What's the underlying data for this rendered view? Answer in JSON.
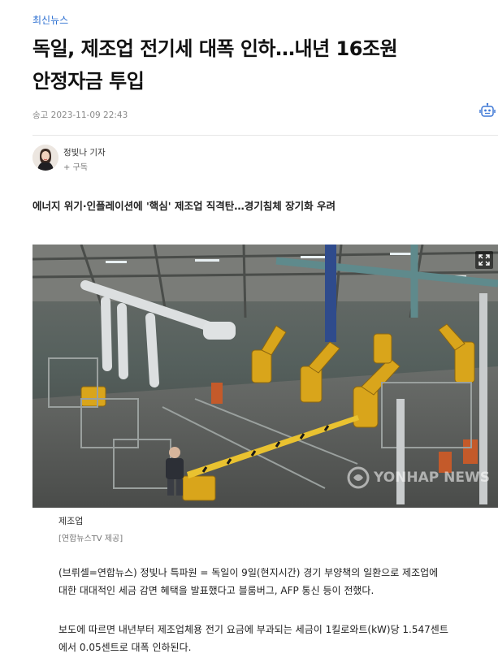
{
  "article": {
    "category": "최신뉴스",
    "title_line1": "독일, 제조업 전기세 대폭 인하…내년 16조원",
    "title_line2": "안정자금 투입",
    "send_time": "송고 2023-11-09 22:43",
    "reporter_name": "정빛나 기자",
    "subscribe_label": "+ 구독",
    "subtitle": "에너지 위기·인플레이션에 '핵심' 제조업 직격탄…경기침체 장기화 우려",
    "photo": {
      "watermark": "YONHAP NEWS",
      "caption": "제조업",
      "credit": "[연합뉴스TV 제공]"
    },
    "paragraphs": [
      {
        "line1": "(브뤼셀=연합뉴스) 정빛나 특파원 = 독일이 9일(현지시간) 경기 부양책의 일환으로 제조업에",
        "line2": "대한 대대적인 세금 감면 혜택을 발표했다고 블룸버그, AFP 통신 등이 전했다."
      },
      {
        "line1": "보도에 따르면 내년부터 제조업체용 전기 요금에 부과되는 세금이 1킬로와트(kW)당 1.547센트",
        "line2": "에서 0.05센트로 대폭 인하된다."
      }
    ]
  },
  "colors": {
    "category": "#2c6fd1",
    "tts_icon": "#3f78d6"
  },
  "icons": [
    "robot-tts-icon",
    "expand-icon",
    "yonhap-logo-icon"
  ]
}
